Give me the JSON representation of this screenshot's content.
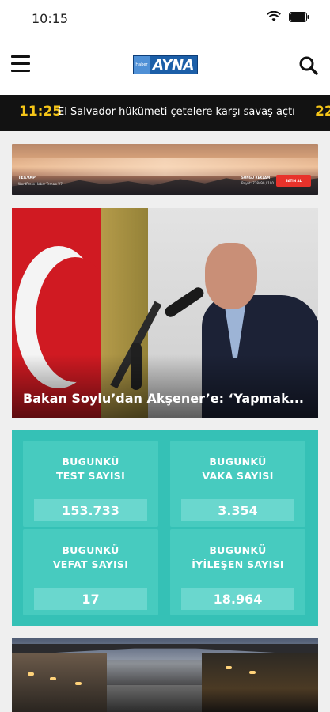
{
  "status_bar": {
    "time": "10:15"
  },
  "header": {
    "logo_small": "Haber",
    "logo_main": "AYNA"
  },
  "ticker": {
    "time": "11:25",
    "headline": "El Salvador hükümeti çetelere karşı savaş açtı",
    "next_time": "22"
  },
  "ad": {
    "left_title": "TEKVAP",
    "left_sub": "WordPress Haber Teması V7",
    "right_title": "SONGÜ REKLAM",
    "right_sub": "Boyut: 728x90 / 100",
    "button": "SATIN AL"
  },
  "headline": {
    "title": "Bakan Soylu’dan Akşener’e: ‘Yapmak..."
  },
  "stats": [
    {
      "label_line1": "BUGUNKÜ",
      "label_line2": "TEST SAYISI",
      "value": "153.733"
    },
    {
      "label_line1": "BUGUNKÜ",
      "label_line2": "VAKA SAYISI",
      "value": "3.354"
    },
    {
      "label_line1": "BUGUNKÜ",
      "label_line2": "VEFAT SAYISI",
      "value": "17"
    },
    {
      "label_line1": "BUGUNKÜ",
      "label_line2": "İYİLEŞEN SAYISI",
      "value": "18.964"
    }
  ],
  "colors": {
    "ticker_time": "#f5c518",
    "stats_bg": "#35c1b6",
    "header_bg": "#ffffff",
    "logo_bg": "#1c5fa8"
  }
}
